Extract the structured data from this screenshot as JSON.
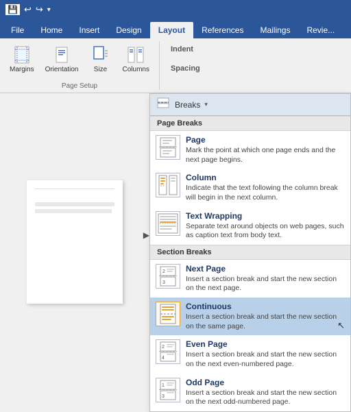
{
  "titleBar": {
    "saveIcon": "💾",
    "undoLabel": "↩",
    "redoLabel": "↪",
    "customizeLabel": "▾"
  },
  "tabs": [
    {
      "id": "file",
      "label": "File"
    },
    {
      "id": "home",
      "label": "Home"
    },
    {
      "id": "insert",
      "label": "Insert"
    },
    {
      "id": "design",
      "label": "Design"
    },
    {
      "id": "layout",
      "label": "Layout",
      "active": true
    },
    {
      "id": "references",
      "label": "References"
    },
    {
      "id": "mailings",
      "label": "Mailings"
    },
    {
      "id": "review",
      "label": "Revie..."
    }
  ],
  "ribbon": {
    "groups": [
      {
        "label": "Page Setup",
        "items": [
          "Margins",
          "Orientation",
          "Size",
          "Columns"
        ]
      }
    ],
    "indentLabel": "Indent",
    "spacingLabel": "Spacing"
  },
  "breaksMenu": {
    "buttonLabel": "Breaks",
    "pageBreaksHeader": "Page Breaks",
    "sectionBreaksHeader": "Section Breaks",
    "items": [
      {
        "id": "page",
        "title": "Page",
        "description": "Mark the point at which one page ends and the next page begins.",
        "iconType": "page"
      },
      {
        "id": "column",
        "title": "Column",
        "description": "Indicate that the text following the column break will begin in the next column.",
        "iconType": "column"
      },
      {
        "id": "text-wrapping",
        "title": "Text Wrapping",
        "description": "Separate text around objects on web pages, such as caption text from body text.",
        "iconType": "textwrap"
      },
      {
        "id": "next-page",
        "title": "Next Page",
        "description": "Insert a section break and start the new section on the next page.",
        "iconType": "nextpage"
      },
      {
        "id": "continuous",
        "title": "Continuous",
        "description": "Insert a section break and start the new section on the same page.",
        "iconType": "continuous",
        "highlighted": true
      },
      {
        "id": "even-page",
        "title": "Even Page",
        "description": "Insert a section break and start the new section on the next even-numbered page.",
        "iconType": "evenpage"
      },
      {
        "id": "odd-page",
        "title": "Odd Page",
        "description": "Insert a section break and start the new section on the next odd-numbered page.",
        "iconType": "oddpage"
      }
    ]
  }
}
